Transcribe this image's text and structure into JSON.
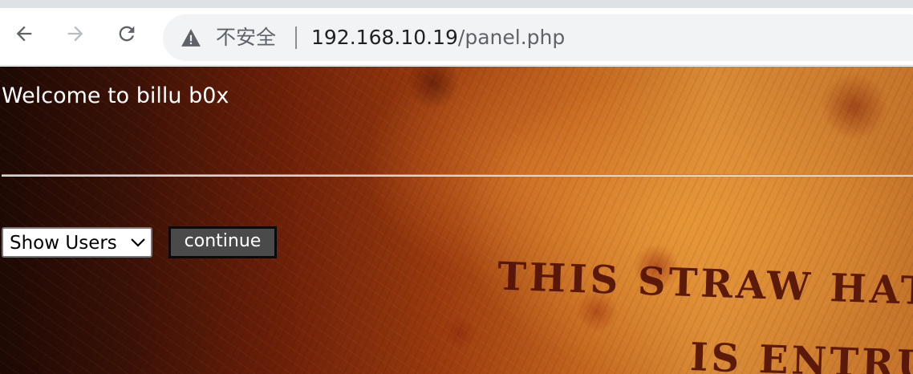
{
  "browser": {
    "nav": {
      "back_icon": "arrow-left-icon",
      "forward_icon": "arrow-right-icon",
      "reload_icon": "reload-icon"
    },
    "address_bar": {
      "security_icon": "warning-triangle-icon",
      "security_label": "不安全",
      "url_host": "192.168.10.19",
      "url_path": "/panel.php"
    }
  },
  "page": {
    "welcome_text": "Welcome to billu b0x",
    "select": {
      "selected": "Show Users",
      "icon": "chevron-down-icon"
    },
    "continue_label": "continue",
    "background_text": {
      "line1": "THIS STRAW HAT",
      "line2": "IS ENTRUS"
    }
  }
}
